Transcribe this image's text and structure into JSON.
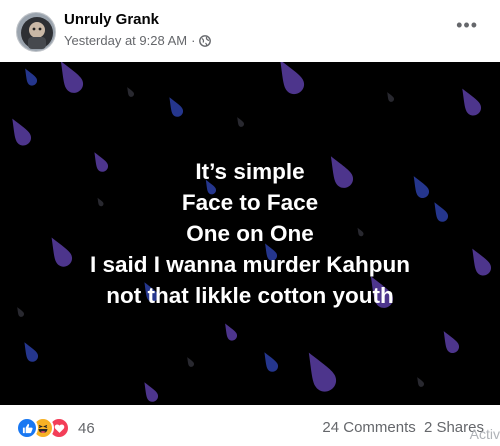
{
  "post": {
    "author": "Unruly Grank",
    "timestamp": "Yesterday at 9:28 AM",
    "separator": "·",
    "audience_icon": "globe-icon",
    "more_label": "•••",
    "background_color": "#000000",
    "lines": [
      "It’s simple",
      "Face to Face",
      "One on One",
      "I said I wanna murder Kahpun",
      "not that likkle cotton youth"
    ]
  },
  "footer": {
    "reaction_icons": [
      "like-icon",
      "haha-icon",
      "love-icon"
    ],
    "reaction_count": "46",
    "comments": "24 Comments",
    "shares": "2 Shares"
  },
  "overlay": {
    "watermark": "Activ"
  },
  "colors": {
    "drop_purple": "#5b3fa6",
    "drop_blue": "#2a3d9e",
    "like_blue": "#1877f2",
    "love_red": "#f33e58",
    "haha_yellow": "#f7b125"
  }
}
